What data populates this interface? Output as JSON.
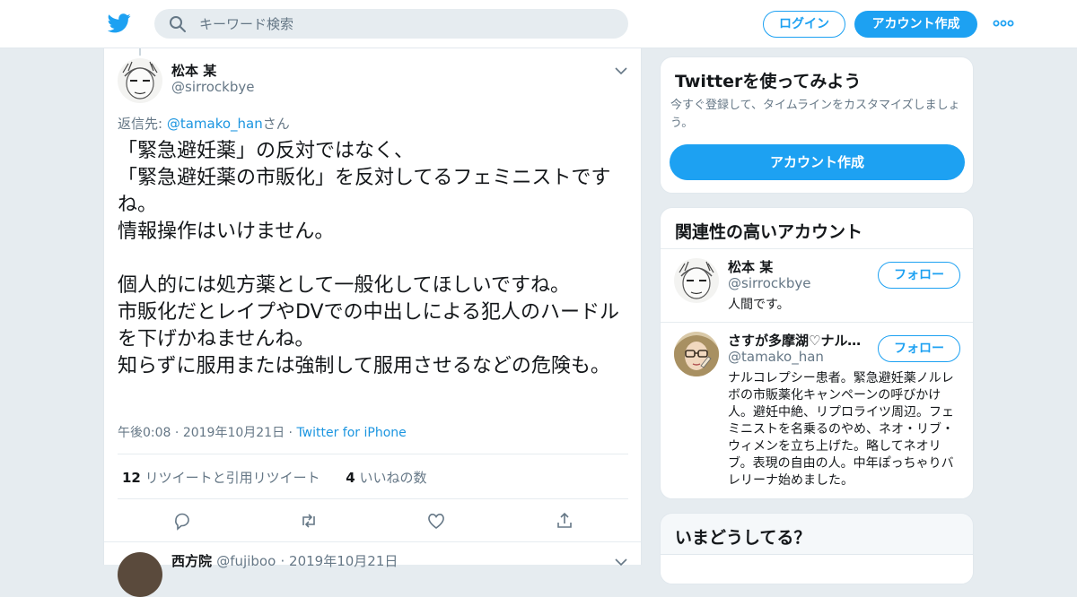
{
  "header": {
    "logo_icon": "twitter-bird-icon",
    "search_placeholder": "キーワード検索",
    "login_label": "ログイン",
    "signup_label": "アカウント作成",
    "more_icon": "more-dots-icon",
    "brand_color": "#1da1f2"
  },
  "tweet": {
    "name": "松本 某",
    "handle": "@sirrockbye",
    "reply_prefix": "返信先: ",
    "reply_handle": "@tamako_han",
    "reply_suffix": "さん",
    "text": "「緊急避妊薬」の反対ではなく、\n「緊急避妊薬の市販化」を反対してるフェミニストですね。\n情報操作はいけません。\n\n個人的には処方薬として一般化してほしいですね。\n市販化だとレイプやDVでの中出しによる犯人のハードルを下げかねませんね。\n知らずに服用または強制して服用させるなどの危険も。",
    "time": "午後0:08",
    "date": "2019年10月21日",
    "source": "Twitter for iPhone",
    "retweet_count": "12",
    "retweet_label": "リツイートと引用リツイート",
    "like_count": "4",
    "like_label": "いいねの数"
  },
  "next_tweet": {
    "name": "西方院",
    "handle": "@fujiboo",
    "date": "2019年10月21日"
  },
  "sidebar": {
    "signup_card": {
      "title": "Twitterを使ってみよう",
      "description": "今すぐ登録して、タイムラインをカスタマイズしましょう。",
      "button_label": "アカウント作成"
    },
    "related": {
      "title": "関連性の高いアカウント",
      "accounts": [
        {
          "name": "松本 某",
          "handle": "@sirrockbye",
          "bio": "人間です。",
          "follow_label": "フォロー"
        },
        {
          "name": "さすが多摩湖♡ナルコレプシー",
          "handle": "@tamako_han",
          "bio": "ナルコレプシー患者。緊急避妊薬ノルレボの市販薬化キャンペーンの呼びかけ人。避妊中絶、リプロライツ周辺。フェミニストを名乗るのやめ、ネオ・リブ・ウィメンを立ち上げた。略してネオリブ。表現の自由の人。中年ぽっちゃりバレリーナ始めました。",
          "follow_label": "フォロー"
        }
      ]
    },
    "trends_title": "いまどうしてる？"
  }
}
